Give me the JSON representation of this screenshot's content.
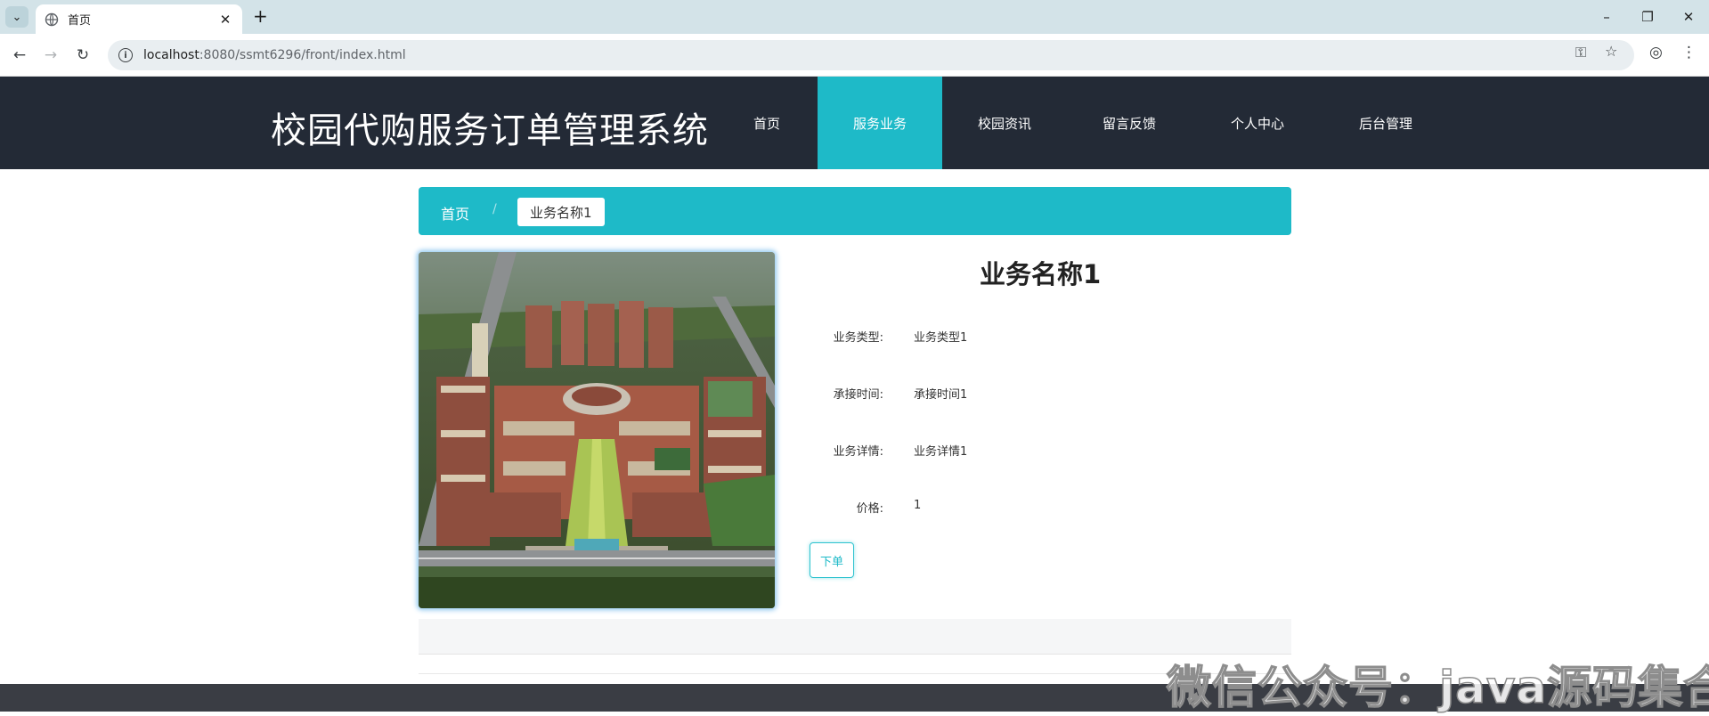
{
  "browser": {
    "tab_title": "首页",
    "url_host": "localhost",
    "url_path": ":8080/ssmt6296/front/index.html"
  },
  "site": {
    "title": "校园代购服务订单管理系统",
    "nav": [
      {
        "label": "首页"
      },
      {
        "label": "服务业务",
        "active": true
      },
      {
        "label": "校园资讯"
      },
      {
        "label": "留言反馈"
      },
      {
        "label": "个人中心"
      },
      {
        "label": "后台管理"
      }
    ],
    "accent_color": "#1ebac8",
    "header_color": "#232a36"
  },
  "breadcrumb": {
    "home": "首页",
    "separator": "/",
    "current": "业务名称1"
  },
  "detail": {
    "title": "业务名称1",
    "rows": [
      {
        "label": "业务类型:",
        "value": "业务类型1"
      },
      {
        "label": "承接时间:",
        "value": "承接时间1"
      },
      {
        "label": "业务详情:",
        "value": "业务详情1"
      },
      {
        "label": "价格:",
        "value": "1"
      }
    ],
    "order_button": "下单"
  },
  "watermark": "微信公众号：java源码集合"
}
